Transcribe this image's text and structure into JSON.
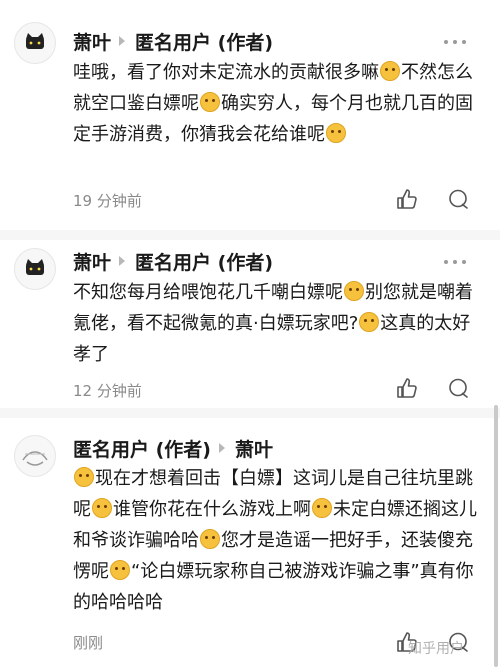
{
  "comments": [
    {
      "author": "萧叶",
      "reply_to": "匿名用户 (作者)",
      "text_parts": [
        "哇哦，看了你对未定流水的贡献很多嘛",
        "emoji",
        "不然怎么就空口鉴白嫖呢",
        "emoji",
        "确实穷人，每个月也就几百的固定手游消费，你猜我会花给谁呢",
        "emoji"
      ],
      "time": "19 分钟前"
    },
    {
      "author": "萧叶",
      "reply_to": "匿名用户 (作者)",
      "text_parts": [
        "不知您每月给喂饱花几千嘲白嫖呢",
        "emoji",
        "别您就是嘲着氪佬，看不起微氪的真·白嫖玩家吧?",
        "emoji",
        "这真的太好孝了"
      ],
      "time": "12 分钟前"
    },
    {
      "author": "匿名用户 (作者)",
      "reply_to": "萧叶",
      "text_parts": [
        "emoji",
        "现在才想着回击【白嫖】这词儿是自己往坑里跳呢",
        "emoji",
        "谁管你花在什么游戏上啊",
        "emoji",
        "未定白嫖还搁这儿和爷谈诈骗哈哈",
        "emoji",
        "您才是造谣一把好手，还装傻充愣呢",
        "emoji",
        "“论白嫖玩家称自己被游戏诈骗之事”真有你的哈哈哈哈"
      ],
      "time": "刚刚"
    }
  ],
  "watermark": "知乎用户",
  "icons": {
    "like": "thumbs-up-icon",
    "reply": "comment-bubble-icon",
    "more": "more-dots-icon",
    "emoji": "emoji-icon"
  }
}
